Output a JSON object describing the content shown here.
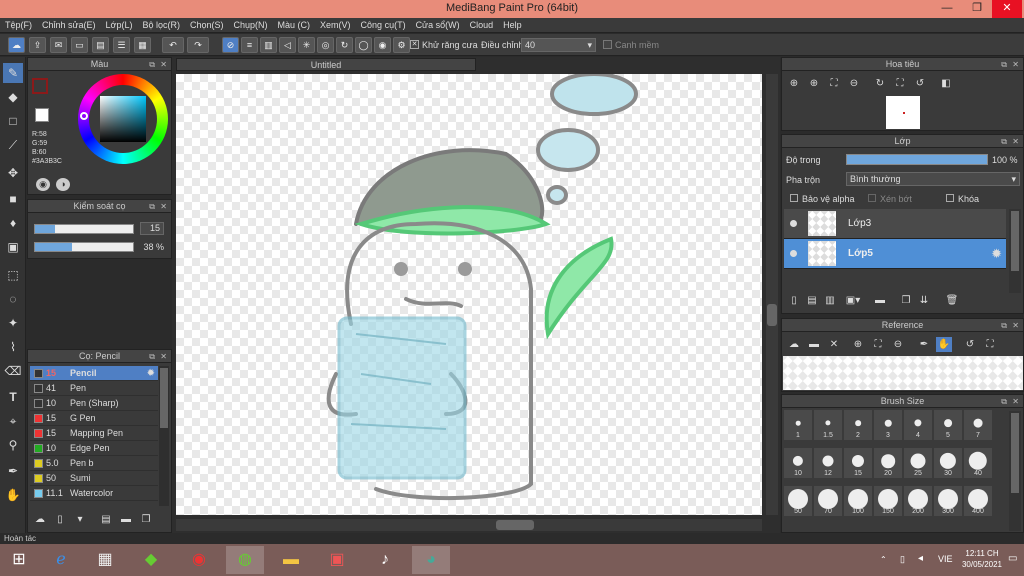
{
  "window": {
    "title": "MediBang Paint Pro (64bit)",
    "min": "—",
    "max": "❐",
    "close": "✕"
  },
  "menu": [
    "Tệp(F)",
    "Chỉnh sửa(E)",
    "Lớp(L)",
    "Bộ lọc(R)",
    "Chọn(S)",
    "Chụp(N)",
    "Màu (C)",
    "Xem(V)",
    "Công cụ(T)",
    "Cửa sổ(W)",
    "Cloud",
    "Help"
  ],
  "toolbar": {
    "antialias_label": "Khử răng cưa",
    "correction_label": "Điều chỉnh",
    "correction_value": "40",
    "edge_label": "Canh mềm"
  },
  "color_panel": {
    "title": "Màu",
    "r": "R:58",
    "g": "G:59",
    "b": "B:60",
    "hex": "#3A3B3C",
    "primary_color": "#8b1a1a",
    "secondary_color": "#ffffff"
  },
  "brush_control": {
    "title": "Kiểm soát cọ",
    "size_value": "15",
    "opacity_value": "38 %",
    "size_fill_percent": 20,
    "opacity_fill_percent": 38
  },
  "brush_panel": {
    "title": "Cọ: Pencil",
    "items": [
      {
        "num": "15",
        "name": "Pencil",
        "color": "#333333"
      },
      {
        "num": "41",
        "name": "Pen",
        "color": "#333333"
      },
      {
        "num": "10",
        "name": "Pen (Sharp)",
        "color": "#333333"
      },
      {
        "num": "15",
        "name": "G Pen",
        "color": "#ee3333"
      },
      {
        "num": "15",
        "name": "Mapping Pen",
        "color": "#ee3333"
      },
      {
        "num": "10",
        "name": "Edge Pen",
        "color": "#22aa22"
      },
      {
        "num": "5.0",
        "name": "Pen b",
        "color": "#ddcc22"
      },
      {
        "num": "50",
        "name": "Sumi",
        "color": "#ddcc22"
      },
      {
        "num": "11.1",
        "name": "Watercolor",
        "color": "#77ccee"
      }
    ]
  },
  "document": {
    "tab": "Untitled"
  },
  "navigator": {
    "title": "Hoa tiêu"
  },
  "layer_panel": {
    "title": "Lớp",
    "opacity_label": "Độ trong",
    "opacity_value": "100 %",
    "opacity_fill_percent": 100,
    "blend_label": "Pha trộn",
    "blend_value": "Bình thường",
    "protect_alpha": "Bảo vệ alpha",
    "clipping": "Xén bớt",
    "lock": "Khóa",
    "layers": [
      {
        "name": "Lớp3"
      },
      {
        "name": "Lớp5"
      }
    ]
  },
  "reference": {
    "title": "Reference"
  },
  "brush_size": {
    "title": "Brush Size",
    "sizes": [
      "1",
      "1.5",
      "2",
      "3",
      "4",
      "5",
      "7",
      "10",
      "12",
      "15",
      "20",
      "25",
      "30",
      "40",
      "50",
      "70",
      "100",
      "150",
      "200",
      "300",
      "400"
    ]
  },
  "status": {
    "text": "Hoàn tác"
  },
  "taskbar": {
    "time": "12:11 CH",
    "date": "30/05/2021",
    "lang": "VIE"
  }
}
